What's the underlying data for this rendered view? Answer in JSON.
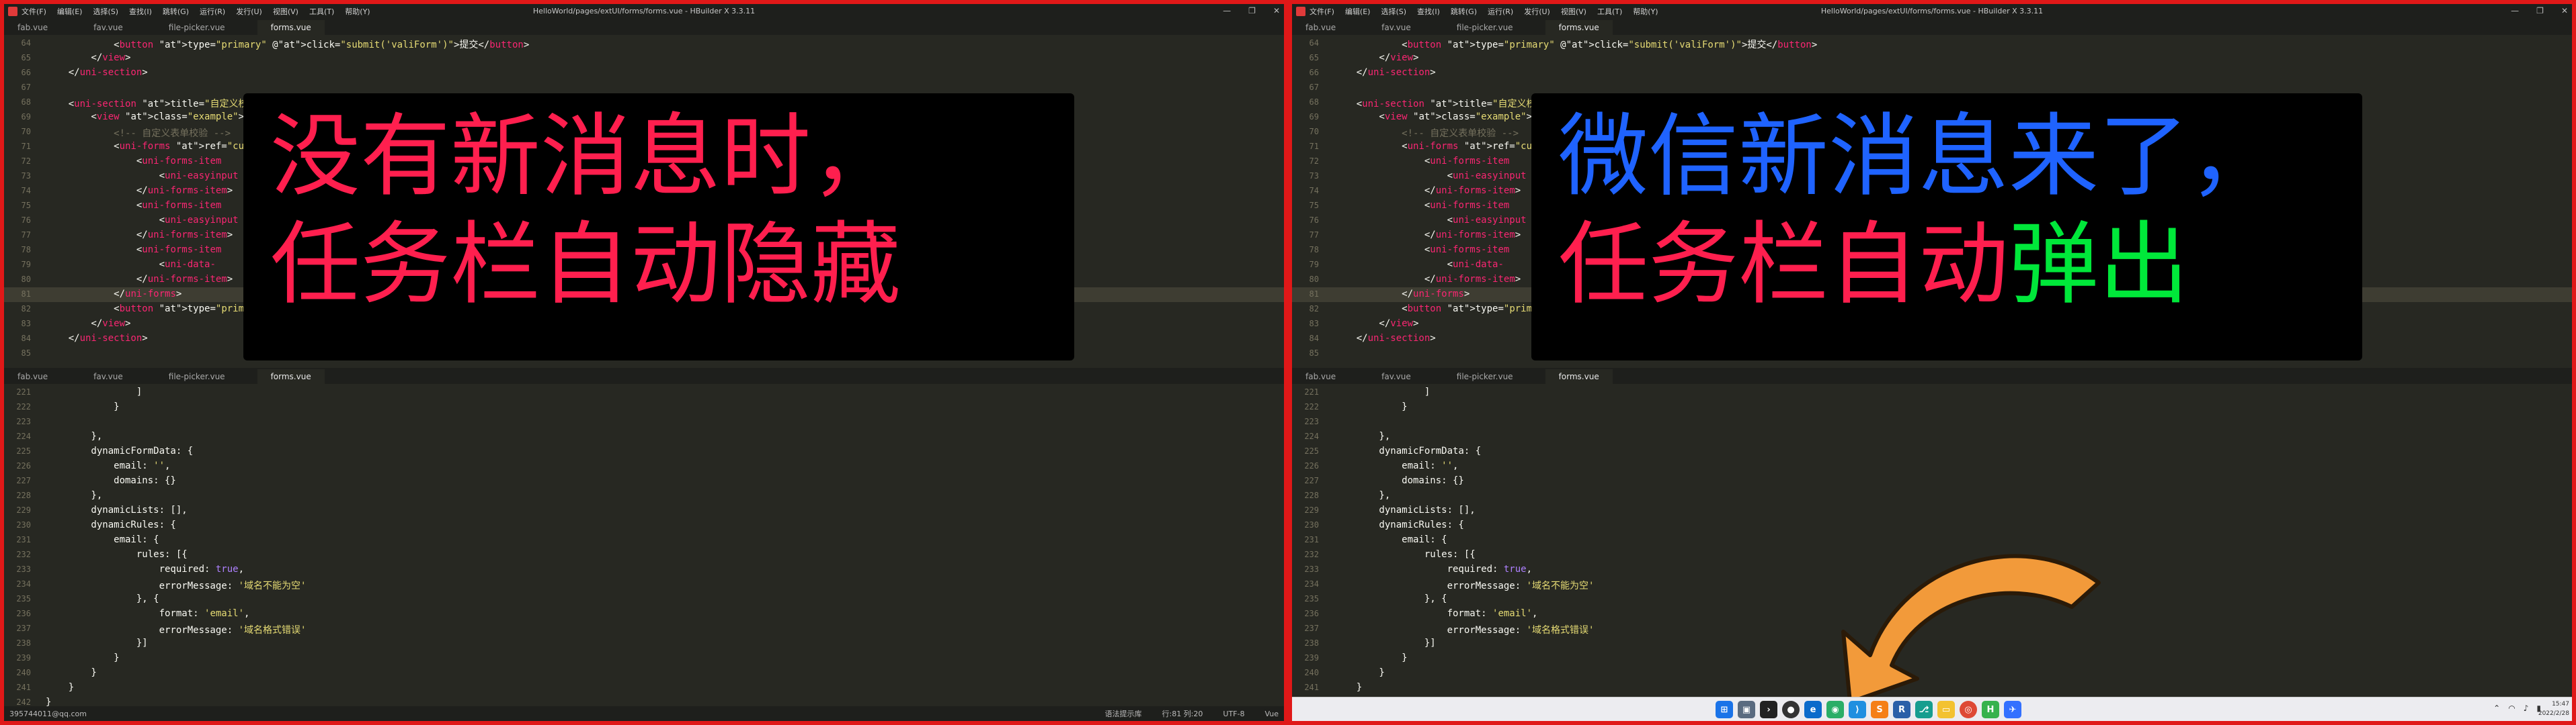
{
  "window": {
    "title": "HelloWorld/pages/extUI/forms/forms.vue - HBuilder X 3.3.11",
    "menu": [
      "文件(F)",
      "编辑(E)",
      "选择(S)",
      "查找(I)",
      "跳转(G)",
      "运行(R)",
      "发行(U)",
      "视图(V)",
      "工具(T)",
      "帮助(Y)"
    ],
    "controls": [
      "—",
      "❐",
      "✕"
    ]
  },
  "tabs": [
    {
      "label": "fab.vue",
      "active": false
    },
    {
      "label": "fav.vue",
      "active": false
    },
    {
      "label": "file-picker.vue",
      "active": false
    },
    {
      "label": "forms.vue",
      "active": true
    }
  ],
  "editor_top": {
    "line_numbers": [
      "64",
      "65",
      "66",
      "67",
      "68",
      "69",
      "70",
      "71",
      "72",
      "73",
      "74",
      "75",
      "76",
      "77",
      "78",
      "79",
      "80",
      "81",
      "82",
      "83",
      "84",
      "85"
    ],
    "lines": [
      "            <button type=\"primary\" @click=\"submit('valiForm')\">提交</button>",
      "        </view>",
      "    </uni-section>",
      "",
      "    <uni-section title=\"自定义校验规则\" type=\"line\">",
      "        <view class=\"example\">",
      "            <!-- 自定义表单校验 -->",
      "            <uni-forms ref=\"customForm\">",
      "                <uni-forms-item",
      "                    <uni-easyinput",
      "                </uni-forms-item>",
      "                <uni-forms-item",
      "                    <uni-easyinput",
      "                </uni-forms-item>",
      "                <uni-forms-item",
      "                    <uni-data-",
      "                </uni-forms-item>",
      "            </uni-forms>",
      "            <button type=\"primary\">",
      "        </view>",
      "    </uni-section>",
      ""
    ]
  },
  "editor_bottom": {
    "line_numbers": [
      "221",
      "222",
      "223",
      "224",
      "225",
      "226",
      "227",
      "228",
      "229",
      "230",
      "231",
      "232",
      "233",
      "234",
      "235",
      "236",
      "237",
      "238",
      "239",
      "240",
      "241",
      "242"
    ],
    "lines": [
      "                ]",
      "            }",
      "",
      "        },",
      "        dynamicFormData: {",
      "            email: '',",
      "            domains: {}",
      "        },",
      "        dynamicLists: [],",
      "        dynamicRules: {",
      "            email: {",
      "                rules: [{",
      "                    required: true,",
      "                    errorMessage: '域名不能为空'",
      "                }, {",
      "                    format: 'email',",
      "                    errorMessage: '域名格式错误'",
      "                }]",
      "            }",
      "        }",
      "    }",
      "}"
    ]
  },
  "left": {
    "overlay_line1": "没有新消息时，",
    "overlay_line2": "任务栏自动隐藏",
    "statusbar": {
      "user": "395744011@qq.com",
      "syntax": "语法提示库",
      "position": "行:81  列:20",
      "encoding": "UTF-8",
      "lang": "Vue"
    }
  },
  "right": {
    "overlay_line1": "微信新消息来了，",
    "overlay_line2a": "任务栏自动",
    "overlay_line2b": "弹出",
    "taskbar": {
      "icons": [
        "windows-start",
        "task-view",
        "terminal",
        "obs",
        "browser-edge",
        "wechat",
        "vscode",
        "sublime",
        "r-studio",
        "gitkraken",
        "folder",
        "chrome",
        "hbuilderx",
        "feishu"
      ],
      "clock_time": "15:47",
      "clock_date": "2022/2/28"
    }
  },
  "colors": {
    "highlight_red": "#ff1f4e",
    "highlight_blue": "#1f63ff",
    "highlight_green": "#00e83a",
    "border_red": "#e01818",
    "arrow_orange": "#f29a3a"
  }
}
